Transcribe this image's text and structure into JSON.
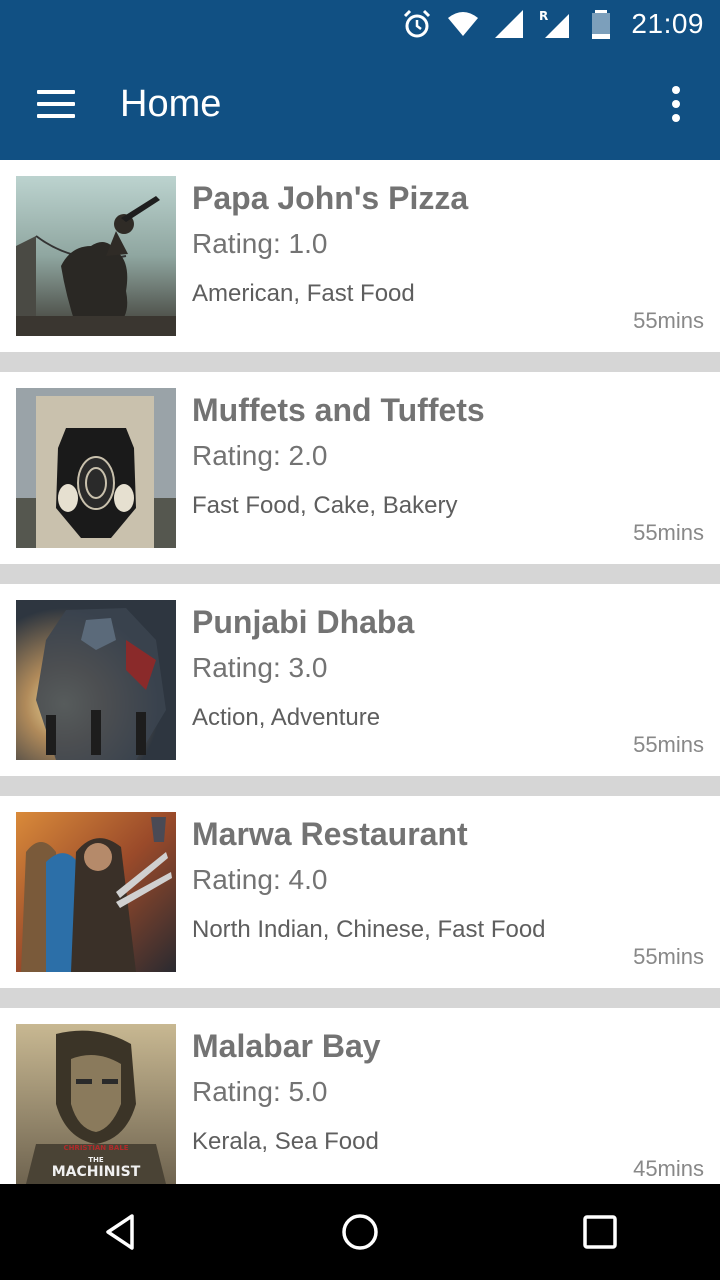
{
  "status_bar": {
    "time": "21:09",
    "icons": [
      "alarm-icon",
      "wifi-icon",
      "signal-icon",
      "roaming-signal-icon",
      "battery-icon"
    ]
  },
  "toolbar": {
    "title": "Home",
    "menu_icon": "hamburger-menu-icon",
    "overflow_icon": "more-vert-icon"
  },
  "restaurants": [
    {
      "name": "Papa John's Pizza",
      "rating": "Rating: 1.0",
      "cuisine": "American, Fast Food",
      "time": "55mins"
    },
    {
      "name": "Muffets and Tuffets",
      "rating": "Rating: 2.0",
      "cuisine": "Fast Food, Cake, Bakery",
      "time": "55mins"
    },
    {
      "name": "Punjabi Dhaba",
      "rating": "Rating: 3.0",
      "cuisine": "Action, Adventure",
      "time": "55mins"
    },
    {
      "name": "Marwa Restaurant",
      "rating": "Rating: 4.0",
      "cuisine": "North Indian, Chinese, Fast Food",
      "time": "55mins"
    },
    {
      "name": "Malabar Bay",
      "rating": "Rating: 5.0",
      "cuisine": "Kerala, Sea Food",
      "time": "45mins"
    }
  ],
  "poster_texts": {
    "machinist_actor": "CHRISTIAN BALE",
    "machinist_the": "THE",
    "machinist_title": "MACHINIST"
  },
  "colors": {
    "app_bar": "#115083",
    "divider": "#d6d6d6",
    "text_primary": "#737373"
  },
  "navigation": {
    "back": "back-icon",
    "home": "home-icon",
    "recents": "recents-icon"
  }
}
